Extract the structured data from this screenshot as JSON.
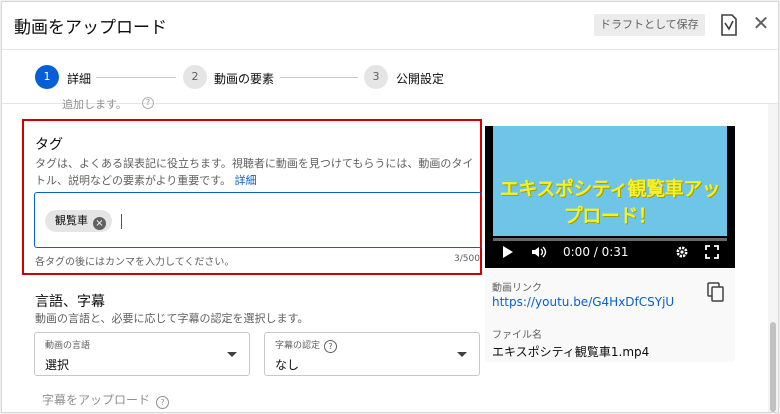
{
  "header": {
    "title": "動画をアップロード",
    "draft_button": "ドラフトとして保存",
    "close_icon": "close-icon",
    "feedback_icon": "feedback-icon"
  },
  "stepper": {
    "steps": [
      {
        "num": "1",
        "label": "詳細",
        "active": true
      },
      {
        "num": "2",
        "label": "動画の要素",
        "active": false
      },
      {
        "num": "3",
        "label": "公開設定",
        "active": false
      }
    ]
  },
  "cut_text": "追加します。",
  "tags": {
    "heading": "タグ",
    "description": "タグは、よくある誤表記に役立ちます。視聴者に動画を見つけてもらうには、動画のタイトル、説明などの要素がより重要です。",
    "details_link": "詳細",
    "chip": "観覧車",
    "hint": "各タグの後にはカンマを入力してください。",
    "count": "3/500"
  },
  "language": {
    "heading": "言語、字幕",
    "description": "動画の言語と、必要に応じて字幕の認定を選択します。",
    "video_language": {
      "label": "動画の言語",
      "value": "選択"
    },
    "caption_cert": {
      "label": "字幕の認定",
      "value": "なし"
    },
    "upload_subtitles": "字幕をアップロード"
  },
  "video": {
    "overlay_text": "エキスポシティ観覧車アップロード！",
    "time": "0:00 / 0:31",
    "link_label": "動画リンク",
    "link_url": "https://youtu.be/G4HxDfCSYjU",
    "file_label": "ファイル名",
    "file_name": "エキスポシティ観覧車1.mp4"
  },
  "colors": {
    "accent": "#065fd4",
    "highlight_border": "#d40000",
    "video_bg": "#6fc5e8",
    "video_text": "#f4f02a"
  }
}
